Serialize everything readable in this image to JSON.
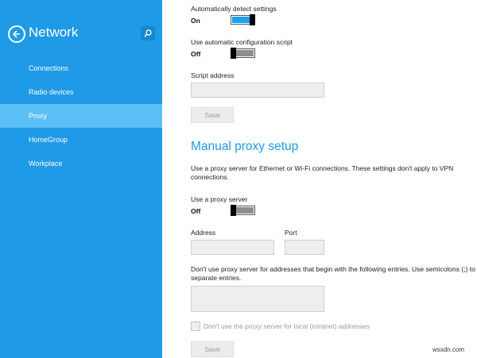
{
  "sidebar": {
    "title": "Network",
    "items": [
      {
        "label": "Connections",
        "active": false
      },
      {
        "label": "Radio devices",
        "active": false
      },
      {
        "label": "Proxy",
        "active": true
      },
      {
        "label": "HomeGroup",
        "active": false
      },
      {
        "label": "Workplace",
        "active": false
      }
    ],
    "icons": {
      "back": "back-arrow-icon",
      "search": "search-icon"
    },
    "colors": {
      "background": "#1e9ae6",
      "active_item": "#5bc0f7"
    }
  },
  "auto": {
    "detect_label": "Automatically detect settings",
    "detect_state": "On",
    "script_label": "Use automatic configuration script",
    "script_state": "Off",
    "address_label": "Script address",
    "address_value": "",
    "save_label": "Save"
  },
  "manual": {
    "title": "Manual proxy setup",
    "description": "Use a proxy server for Ethernet or Wi-Fi connections. These settings don't apply to VPN connections.",
    "use_proxy_label": "Use a proxy server",
    "use_proxy_state": "Off",
    "address_label": "Address",
    "address_value": "",
    "port_label": "Port",
    "port_value": "",
    "exceptions_text": "Don't use proxy server for addresses that begin with the following entries. Use semicolons (;) to separate entries.",
    "exceptions_value": "",
    "local_checkbox_label": "Don't use the proxy server for local (intranet) addresses",
    "local_checkbox_checked": false,
    "save_label": "Save"
  },
  "watermark": "wsxdn.com"
}
